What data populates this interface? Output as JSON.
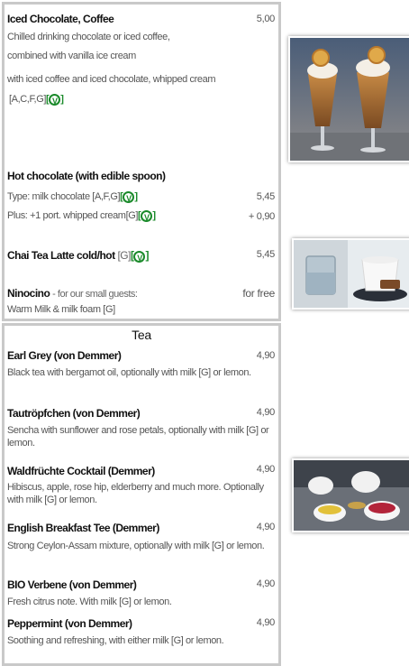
{
  "drinks": {
    "iced": {
      "name": "Iced Chocolate, Coffee",
      "price": "5,00",
      "line1": "Chilled drinking chocolate or iced coffee,",
      "line2": "combined with vanilla ice cream",
      "line3": "with iced coffee and iced chocolate, whipped cream",
      "allergens": "[A,C,F,G]"
    },
    "hot_choc": {
      "name": "Hot chocolate (with edible spoon)",
      "type_line": "Type: milk chocolate [A,F,G]",
      "type_price": "5,45",
      "plus_line": "Plus: +1 port. whipped cream[G]",
      "plus_price": "+ 0,90"
    },
    "chai": {
      "name": "Chai Tea Latte cold/hot",
      "allergens": "[G]",
      "price": "5,45"
    },
    "ninocino": {
      "name": "Ninocino",
      "desc": "- for our small guests:",
      "price": "for free",
      "line2": "Warm Milk & milk foam [G]"
    },
    "veg_symbol": "V"
  },
  "tea": {
    "title": "Tea",
    "items": [
      {
        "name": "Earl Grey (von Demmer)",
        "price": "4,90",
        "desc": "Black tea with bergamot oil, optionally with milk [G] or lemon."
      },
      {
        "name": "Tautröpfchen (von Demmer)",
        "price": "4,90",
        "desc": "Sencha with sunflower and rose petals, optionally with milk [G] or lemon."
      },
      {
        "name": "Waldfrüchte Cocktail (Demmer)",
        "price": "4,90",
        "desc": "Hibiscus, apple, rose hip, elderberry and much more. Optionally with milk [G] or lemon."
      },
      {
        "name": "English Breakfast Tee (Demmer)",
        "price": "4,90",
        "desc": "Strong Ceylon-Assam mixture, optionally with milk [G] or lemon."
      },
      {
        "name": "BIO Verbene (von Demmer)",
        "price": "4,90",
        "desc": "Fresh citrus note. With milk [G] or lemon."
      },
      {
        "name": "Peppermint (von Demmer)",
        "price": "4,90",
        "desc": "Soothing and refreshing, with either milk [G] or lemon."
      }
    ]
  },
  "colors": {
    "veg_green": "#1a8a2a",
    "border": "#c9c9c9"
  }
}
